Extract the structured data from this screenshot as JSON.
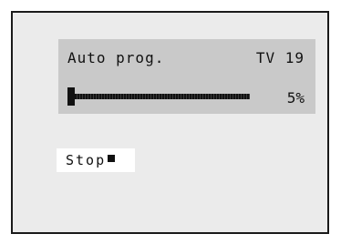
{
  "osd": {
    "title": "Auto prog.",
    "channel": "TV 19",
    "progress_percent": 5,
    "progress_label": "5%"
  },
  "stop": {
    "label": "Stop",
    "icon": "stop-square-icon"
  },
  "colors": {
    "screen_background": "#ebebeb",
    "panel_background": "#c9c9c9",
    "button_background": "#ffffff",
    "text": "#111111"
  }
}
